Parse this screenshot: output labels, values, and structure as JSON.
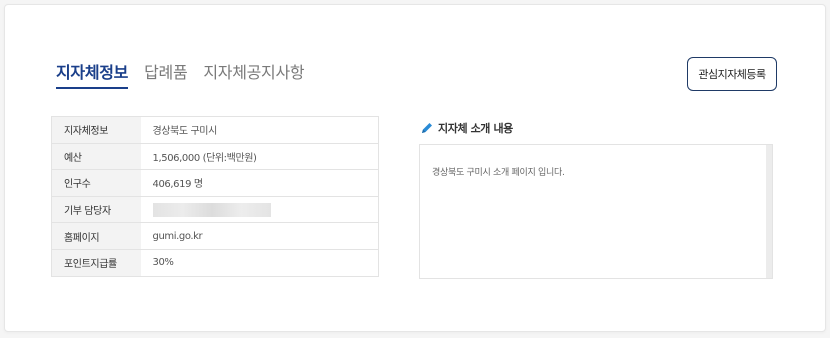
{
  "tabs": [
    {
      "label": "지자체정보"
    },
    {
      "label": "답례품"
    },
    {
      "label": "지자체공지사항"
    }
  ],
  "favorite_button": {
    "label": "관심지자체등록"
  },
  "info_rows": [
    {
      "label": "지자체정보",
      "value": "경상북도 구미시"
    },
    {
      "label": "예산",
      "value": "1,506,000 (단위:백만원)"
    },
    {
      "label": "인구수",
      "value": "406,619 명"
    },
    {
      "label": "기부 담당자",
      "value": ""
    },
    {
      "label": "홈페이지",
      "value": "gumi.go.kr"
    },
    {
      "label": "포인트지급률",
      "value": "30%"
    }
  ],
  "intro": {
    "heading": "지자체 소개 내용",
    "text": "경상북도 구미시 소개 페이지 입니다."
  },
  "colors": {
    "accent": "#1a3f8a",
    "pencil": "#2a8bd6"
  }
}
